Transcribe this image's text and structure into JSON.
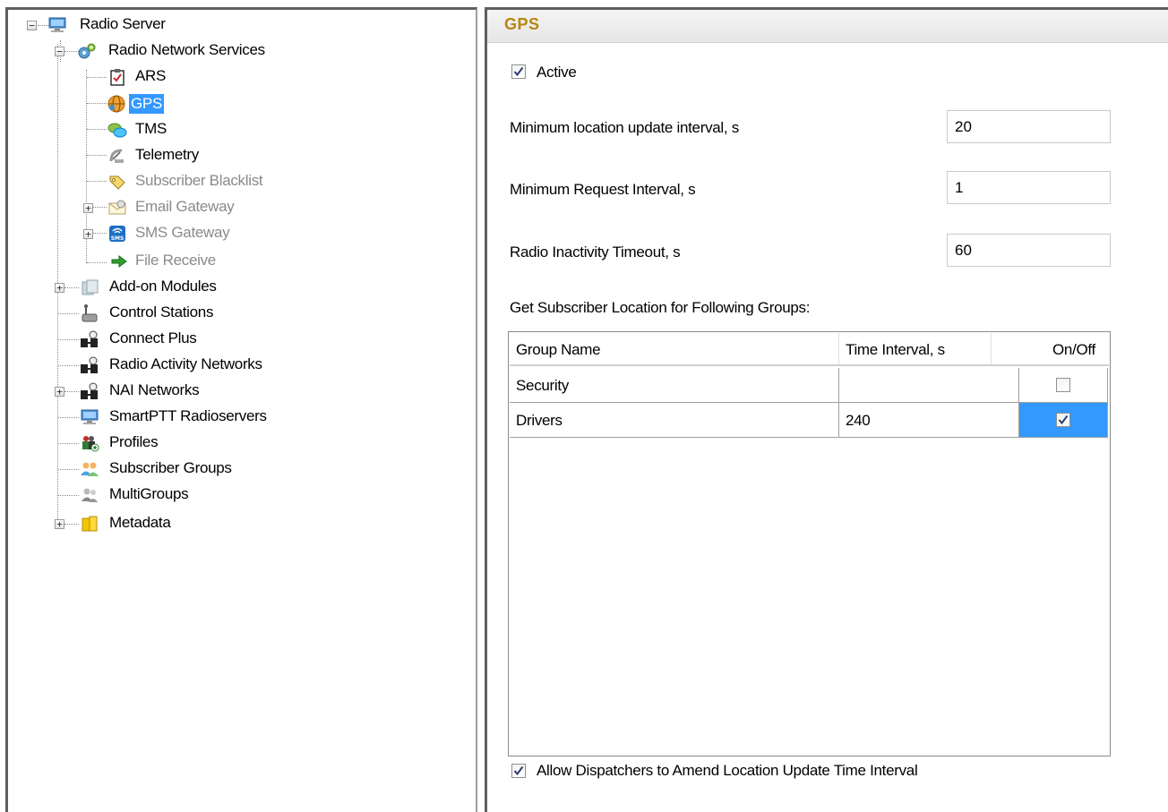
{
  "tree": {
    "items": [
      {
        "label": "Radio Server",
        "dim": false,
        "selected": false
      },
      {
        "label": "Radio Network Services",
        "dim": false,
        "selected": false
      },
      {
        "label": "ARS",
        "dim": false,
        "selected": false
      },
      {
        "label": "GPS",
        "dim": false,
        "selected": true
      },
      {
        "label": "TMS",
        "dim": false,
        "selected": false
      },
      {
        "label": "Telemetry",
        "dim": false,
        "selected": false
      },
      {
        "label": "Subscriber Blacklist",
        "dim": true,
        "selected": false
      },
      {
        "label": "Email Gateway",
        "dim": true,
        "selected": false
      },
      {
        "label": "SMS Gateway",
        "dim": true,
        "selected": false
      },
      {
        "label": "File Receive",
        "dim": true,
        "selected": false
      },
      {
        "label": "Add-on Modules",
        "dim": false,
        "selected": false
      },
      {
        "label": "Control Stations",
        "dim": false,
        "selected": false
      },
      {
        "label": "Connect Plus",
        "dim": false,
        "selected": false
      },
      {
        "label": "Radio Activity Networks",
        "dim": false,
        "selected": false
      },
      {
        "label": "NAI Networks",
        "dim": false,
        "selected": false
      },
      {
        "label": "SmartPTT Radioservers",
        "dim": false,
        "selected": false
      },
      {
        "label": "Profiles",
        "dim": false,
        "selected": false
      },
      {
        "label": "Subscriber Groups",
        "dim": false,
        "selected": false
      },
      {
        "label": "MultiGroups",
        "dim": false,
        "selected": false
      },
      {
        "label": "Metadata",
        "dim": false,
        "selected": false
      }
    ],
    "icons": {
      "radio_server": "computer-icon",
      "radio_network_services": "gears-icon",
      "ars": "clipboard-check-icon",
      "gps": "globe-icon",
      "tms": "chat-bubbles-icon",
      "telemetry": "satellite-dish-icon",
      "subscriber_blacklist": "tag-icon",
      "email_gateway": "envelope-icon",
      "sms_gateway": "sms-icon",
      "file_receive": "green-arrow-icon",
      "addon_modules": "puzzle-icon",
      "control_stations": "radio-station-icon",
      "connect_plus": "network-icon",
      "radio_activity_networks": "network-icon",
      "nai_networks": "network-icon",
      "smartptt_radioservers": "computer-icon",
      "profiles": "profiles-icon",
      "subscriber_groups": "users-icon",
      "multigroups": "users-icon",
      "metadata": "database-icon"
    },
    "selection_color": "#3399ff",
    "dim_color": "#8a8a8a"
  },
  "panel": {
    "title": "GPS",
    "title_color": "#b8860b",
    "active_label": "Active",
    "active_checked": true,
    "fields": [
      {
        "label": "Minimum location update interval, s",
        "value": "20"
      },
      {
        "label": "Minimum Request Interval, s",
        "value": "1"
      },
      {
        "label": "Radio Inactivity Timeout, s",
        "value": "60"
      }
    ],
    "groups_label": "Get Subscriber Location for Following Groups:",
    "grid": {
      "columns": [
        "Group Name",
        "Time Interval, s",
        "On/Off"
      ],
      "rows": [
        {
          "group": "Security",
          "interval": "",
          "on": false,
          "selected": false
        },
        {
          "group": "Drivers",
          "interval": "240",
          "on": true,
          "selected": true
        }
      ]
    },
    "allow_label": "Allow Dispatchers to Amend Location Update Time Interval",
    "allow_checked": true
  }
}
